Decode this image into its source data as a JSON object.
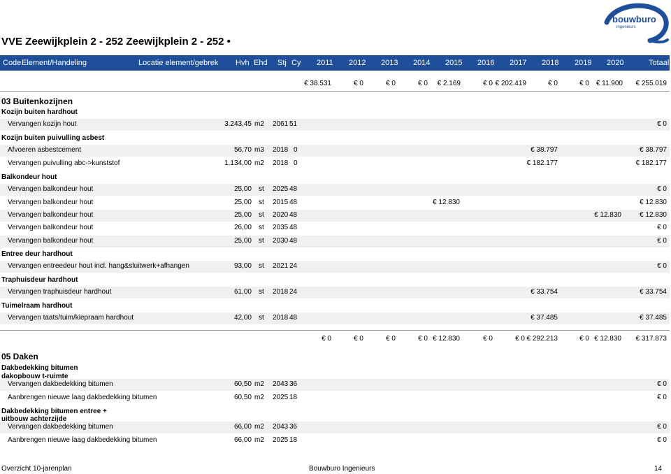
{
  "doc": {
    "title": "VVE Zeewijkplein 2 - 252 Zeewijkplein 2 - 252 •",
    "logo": {
      "name": "bouwburo",
      "tagline": "ingenieurs"
    }
  },
  "columns": {
    "code": "Code",
    "element": "Element/Handeling",
    "location": "Locatie element/gebrek",
    "hvh": "Hvh",
    "ehd": "Ehd",
    "stj": "Stj",
    "cy": "Cy",
    "years": [
      "2011",
      "2012",
      "2013",
      "2014",
      "2015",
      "2016",
      "2017",
      "2018",
      "2019",
      "2020"
    ],
    "total": "Totaal"
  },
  "summary1": [
    "€ 38.531",
    "€ 0",
    "€ 0",
    "€ 0",
    "€ 2.169",
    "€ 0",
    "€ 202.419",
    "€ 0",
    "€ 0",
    "€ 11.900",
    "€ 255.019"
  ],
  "section1": {
    "title": "03  Buitenkozijnen",
    "groups": [
      "Kozijn buiten hardhout",
      "Kozijn buiten puivulling asbest",
      "Balkondeur hout",
      "Entree deur hardhout",
      "Traphuisdeur hardhout",
      "Tuimelraam hardhout"
    ],
    "rows": [
      {
        "label": "Vervangen kozijn hout",
        "hvh": "3.243,45",
        "ehd": "m2",
        "stj": "2061",
        "cy": "51",
        "total": "€ 0"
      },
      {
        "label": "Afvoeren asbestcement",
        "hvh": "56,70",
        "ehd": "m3",
        "stj": "2018",
        "cy": "0",
        "year_val": "€ 38.797",
        "total": "€ 38.797"
      },
      {
        "label": "Vervangen puivulling abc->kunststof",
        "hvh": "1.134,00",
        "ehd": "m2",
        "stj": "2018",
        "cy": "0",
        "year_val": "€ 182.177",
        "total": "€ 182.177"
      },
      {
        "label": "Vervangen balkondeur hout",
        "hvh": "25,00",
        "ehd": "st",
        "stj": "2025",
        "cy": "48",
        "total": "€ 0"
      },
      {
        "label": "Vervangen balkondeur hout",
        "hvh": "25,00",
        "ehd": "st",
        "stj": "2015",
        "cy": "48",
        "year_val": "€ 12.830",
        "total": "€ 12.830"
      },
      {
        "label": "Vervangen balkondeur hout",
        "hvh": "25,00",
        "ehd": "st",
        "stj": "2020",
        "cy": "48",
        "year_val": "€ 12.830",
        "total": "€ 12.830"
      },
      {
        "label": "Vervangen balkondeur hout",
        "hvh": "26,00",
        "ehd": "st",
        "stj": "2035",
        "cy": "48",
        "total": "€ 0"
      },
      {
        "label": "Vervangen balkondeur hout",
        "hvh": "25,00",
        "ehd": "st",
        "stj": "2030",
        "cy": "48",
        "total": "€ 0"
      },
      {
        "label": "Vervangen entreedeur hout incl. hang&sluitwerk+afhangen",
        "hvh": "93,00",
        "ehd": "st",
        "stj": "2021",
        "cy": "24",
        "total": "€ 0"
      },
      {
        "label": "Vervangen traphuisdeur hardhout",
        "hvh": "61,00",
        "ehd": "st",
        "stj": "2018",
        "cy": "24",
        "year_val": "€ 33.754",
        "total": "€ 33.754"
      },
      {
        "label": "Vervangen taats/tuim/kiepraam hardhout",
        "hvh": "42,00",
        "ehd": "st",
        "stj": "2018",
        "cy": "48",
        "year_val": "€ 37.485",
        "total": "€ 37.485"
      }
    ]
  },
  "summary2": [
    "€ 0",
    "€ 0",
    "€ 0",
    "€ 0",
    "€ 12.830",
    "€ 0",
    "€ 0",
    "€ 292.213",
    "€ 0",
    "€ 12.830",
    "€ 317.873"
  ],
  "section2": {
    "title": "05  Daken",
    "groups": [
      "Dakbedekking bitumen dakopbouw t-ruimte",
      "Dakbedekking bitumen entree + uitbouw achterzijde"
    ],
    "rows": [
      {
        "label": "Vervangen dakbedekking bitumen",
        "hvh": "60,50",
        "ehd": "m2",
        "stj": "2043",
        "cy": "36",
        "total": "€ 0"
      },
      {
        "label": "Aanbrengen nieuwe laag dakbedekking bitumen",
        "hvh": "60,50",
        "ehd": "m2",
        "stj": "2025",
        "cy": "18",
        "total": "€ 0"
      },
      {
        "label": "Vervangen dakbedekking bitumen",
        "hvh": "66,00",
        "ehd": "m2",
        "stj": "2043",
        "cy": "36",
        "total": "€ 0"
      },
      {
        "label": "Aanbrengen nieuwe laag dakbedekking bitumen",
        "hvh": "66,00",
        "ehd": "m2",
        "stj": "2025",
        "cy": "18",
        "total": "€ 0"
      }
    ]
  },
  "footer": {
    "left": "Overzicht 10-jarenplan",
    "center": "Bouwburo Ingenieurs",
    "page": "14"
  }
}
